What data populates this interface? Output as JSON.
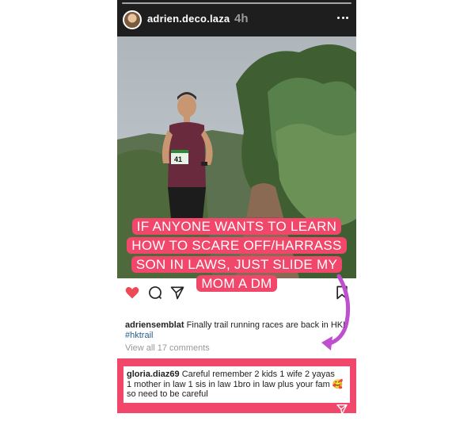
{
  "story": {
    "username": "adrien.deco.laza",
    "time": "4h"
  },
  "post": {
    "sticker_lines": [
      "IF ANYONE WANTS TO LEARN",
      "HOW TO SCARE OFF/HARRASS",
      "SON IN LAWS, JUST SLIDE MY",
      "MOM A DM"
    ],
    "bib_number": "41",
    "caption_user": "adriensemblat",
    "caption_text": "Finally trail running races are back in HK!",
    "hashtag": "#hktrail",
    "view_comments": "View all 17 comments"
  },
  "comment": {
    "user": "gloria.diaz69",
    "text_line1": "Careful  remember 2 kids 1 wife 2 yayas",
    "text_line2": "1 mother in law  1 sis in law 1bro in law plus your fam",
    "emoji": "🥰",
    "text_line3": "so need to be careful"
  },
  "colors": {
    "highlight": "#f0476a",
    "arrow": "#c04fd0",
    "heart": "#ed4956"
  },
  "icons": [
    "more-icon",
    "heart-icon",
    "comment-icon",
    "share-icon",
    "bookmark-icon",
    "arrow-annotation-icon",
    "send-icon"
  ]
}
